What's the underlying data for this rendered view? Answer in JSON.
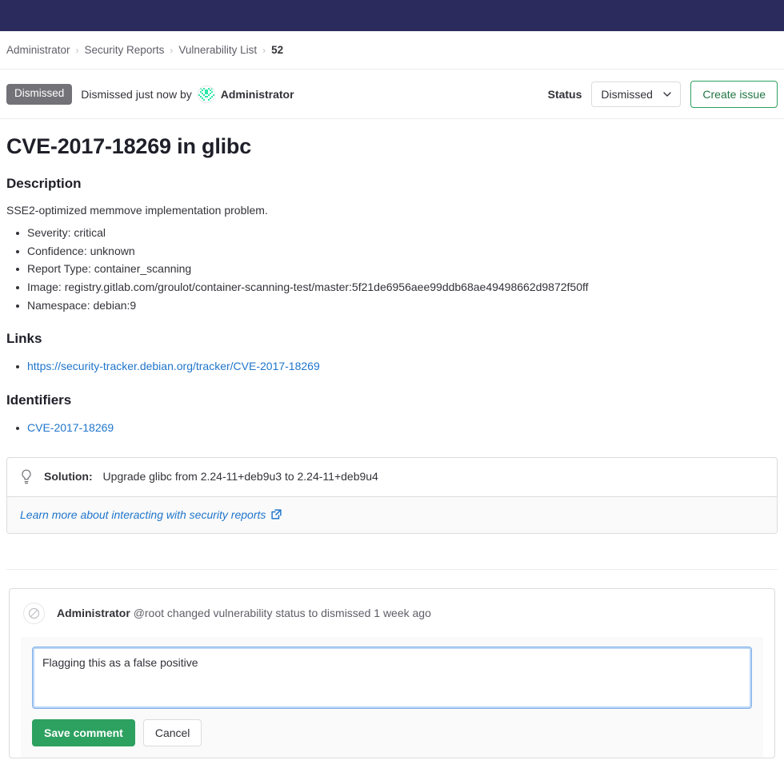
{
  "breadcrumb": {
    "separator": "›",
    "items": [
      {
        "label": "Administrator",
        "active": false
      },
      {
        "label": "Security Reports",
        "active": false
      },
      {
        "label": "Vulnerability List",
        "active": false
      },
      {
        "label": "52",
        "active": true
      }
    ]
  },
  "status_row": {
    "badge": "Dismissed",
    "dismissed_text": "Dismissed just now by",
    "author": "Administrator",
    "status_label": "Status",
    "status_value": "Dismissed",
    "create_issue_label": "Create issue"
  },
  "main": {
    "title": "CVE-2017-18269 in glibc",
    "description_heading": "Description",
    "description_text": "SSE2-optimized memmove implementation problem.",
    "details": [
      "Severity: critical",
      "Confidence: unknown",
      "Report Type: container_scanning",
      "Image: registry.gitlab.com/groulot/container-scanning-test/master:5f21de6956aee99ddb68ae49498662d9872f50ff",
      "Namespace: debian:9"
    ],
    "links_heading": "Links",
    "links": [
      "https://security-tracker.debian.org/tracker/CVE-2017-18269"
    ],
    "identifiers_heading": "Identifiers",
    "identifiers": [
      "CVE-2017-18269"
    ]
  },
  "solution": {
    "label": "Solution:",
    "text": "Upgrade glibc from 2.24-11+deb9u3 to 2.24-11+deb9u4",
    "footer_link": "Learn more about interacting with security reports"
  },
  "activity": {
    "author": "Administrator",
    "text": "@root changed vulnerability status to dismissed 1 week ago"
  },
  "comment_form": {
    "value": "Flagging this as a false positive",
    "placeholder": "",
    "save_label": "Save comment",
    "cancel_label": "Cancel"
  },
  "colors": {
    "topbar": "#2b2b5e",
    "badge_gray": "#737278",
    "green": "#2da160",
    "green_text": "#217645",
    "link_blue": "#1f75cb",
    "focus_blue": "#80b1ea"
  }
}
